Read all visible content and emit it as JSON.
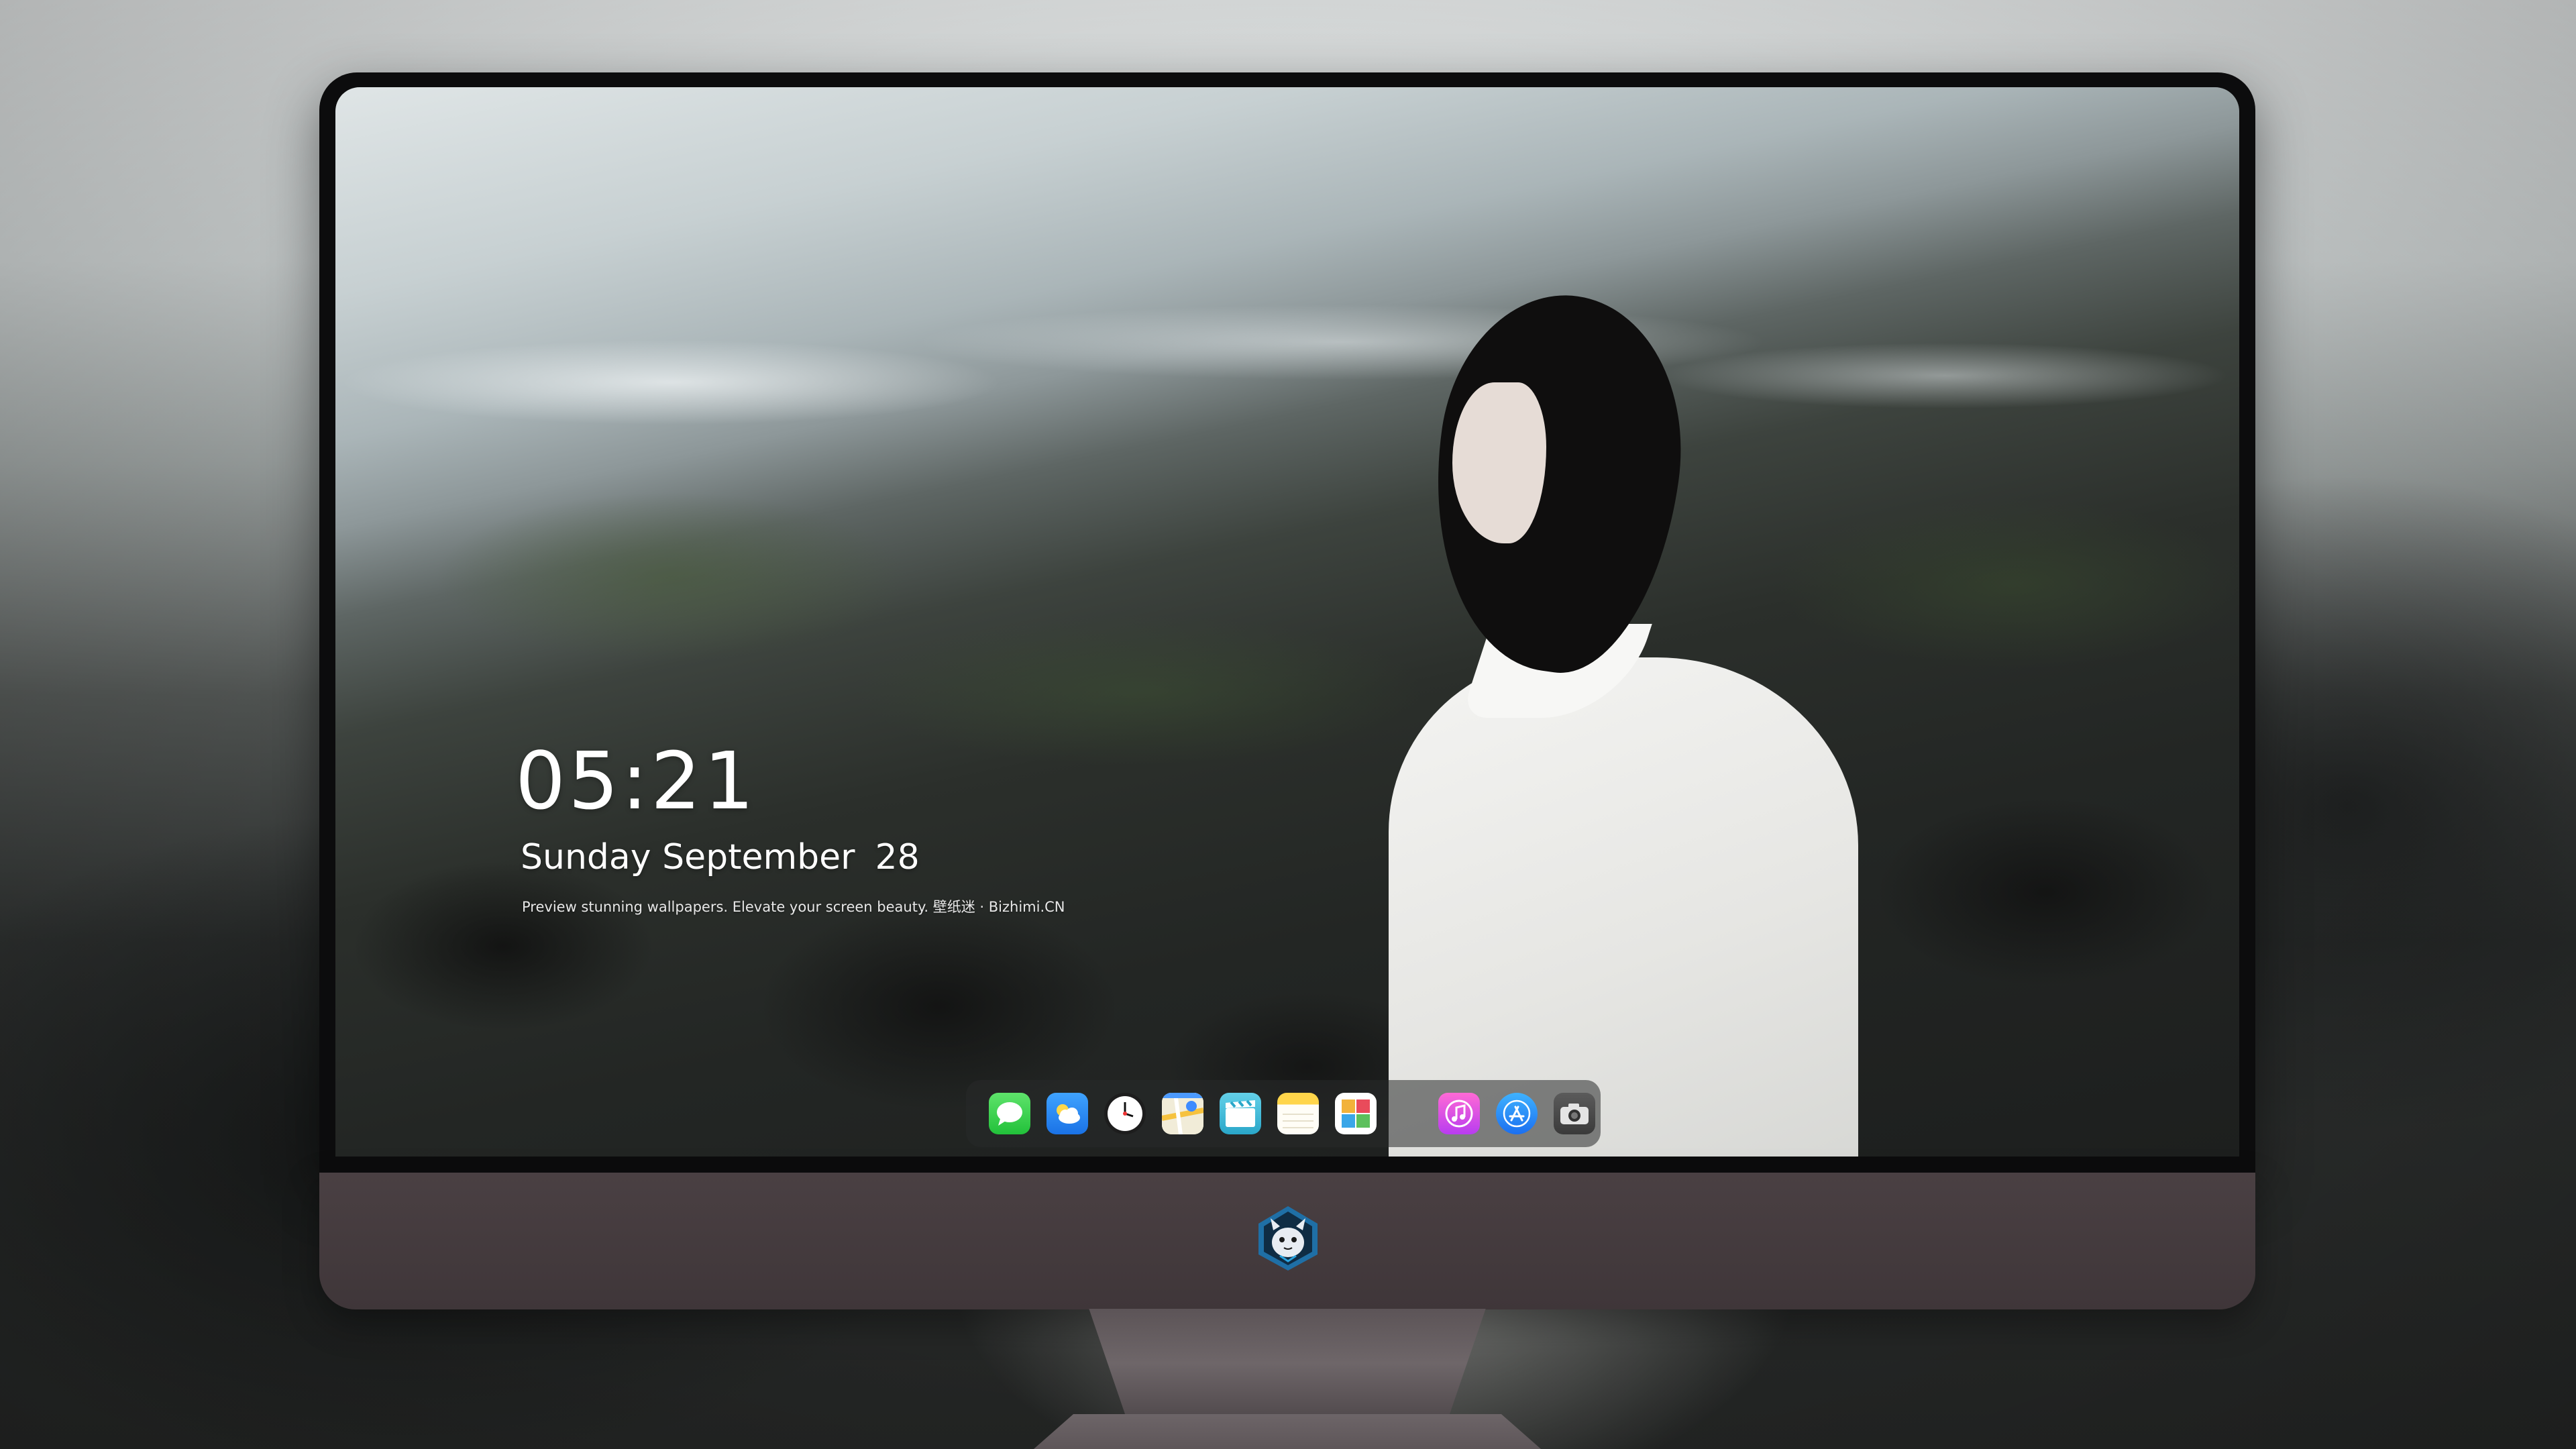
{
  "lockscreen": {
    "time": "05:21",
    "weekday_month": "Sunday September",
    "day": "28",
    "tagline": "Preview stunning wallpapers. Elevate your screen beauty. 壁纸迷 · Bizhimi.CN"
  },
  "dock": {
    "items": [
      {
        "icon": "messages-icon"
      },
      {
        "icon": "weather-icon"
      },
      {
        "icon": "clock-icon"
      },
      {
        "icon": "maps-icon"
      },
      {
        "icon": "clips-icon"
      },
      {
        "icon": "notes-icon"
      },
      {
        "icon": "photos-icon"
      },
      {
        "icon": "music-icon"
      },
      {
        "icon": "app-store-icon"
      },
      {
        "icon": "camera-icon"
      }
    ]
  },
  "monitor": {
    "logo_icon": "bizhimi-mascot-logo"
  }
}
